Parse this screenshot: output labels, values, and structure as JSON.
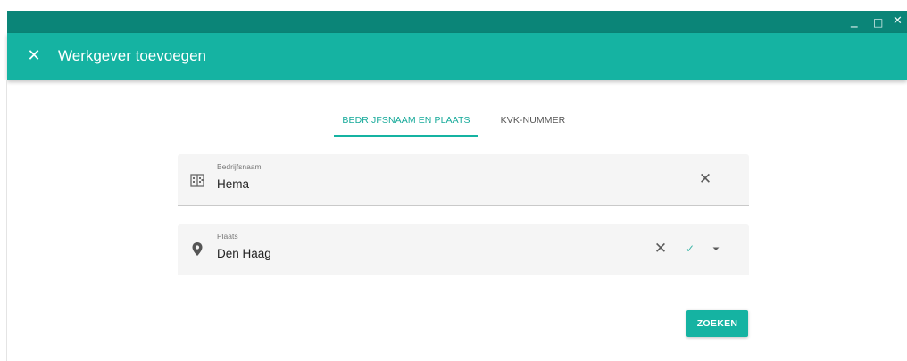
{
  "window": {
    "minimize_glyph": "_",
    "maximize_glyph": "□",
    "close_glyph": "✕"
  },
  "appbar": {
    "close_icon": "close-icon",
    "title": "Werkgever toevoegen"
  },
  "tabs": [
    {
      "label": "BEDRIJFSNAAM EN PLAATS",
      "active": true
    },
    {
      "label": "KVK-NUMMER",
      "active": false
    }
  ],
  "fields": {
    "company": {
      "icon": "building-icon",
      "label": "Bedrijfsnaam",
      "value": "Hema"
    },
    "city": {
      "icon": "location-pin-icon",
      "label": "Plaats",
      "value": "Den Haag"
    }
  },
  "glyphs": {
    "clear": "✕",
    "check": "✓"
  },
  "actions": {
    "search_label": "ZOEKEN"
  },
  "colors": {
    "accent": "#15b3a2",
    "titlebar": "#0b8578",
    "field_bg": "#f5f5f5"
  }
}
